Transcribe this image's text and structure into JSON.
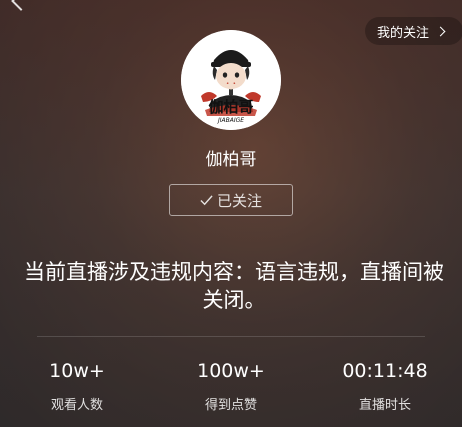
{
  "header": {
    "back_icon": "chevron-left-icon",
    "follow_list_label": "我的关注",
    "follow_list_icon": "chevron-right-icon"
  },
  "profile": {
    "avatar_icon": "avatar-cartoon",
    "avatar_logo_text": "伽柏哥",
    "avatar_logo_subtext": "JIABAIGE",
    "name": "伽柏哥",
    "followed_label": "已关注",
    "followed_icon": "check-icon"
  },
  "notice": {
    "text": "当前直播涉及违规内容：语言违规，直播间被关闭。"
  },
  "stats": [
    {
      "value": "10w+",
      "label": "观看人数"
    },
    {
      "value": "100w+",
      "label": "得到点赞"
    },
    {
      "value": "00:11:48",
      "label": "直播时长"
    }
  ],
  "colors": {
    "bg_warm": "#7a4f3b",
    "bg_dark": "#2f2b2c",
    "text": "#ffffff"
  }
}
